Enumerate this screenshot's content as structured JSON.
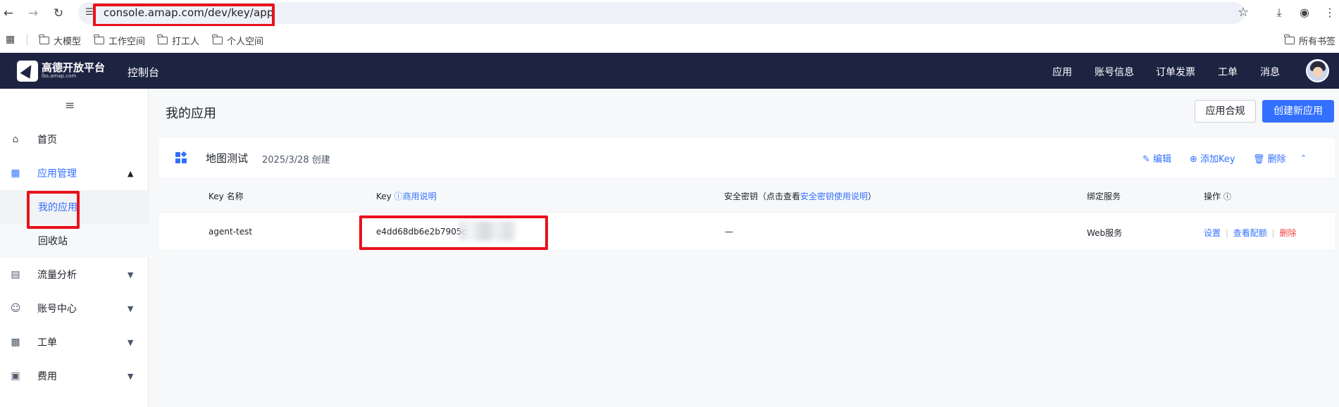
{
  "browser": {
    "url": "console.amap.com/dev/key/app",
    "bookmarks": [
      "大模型",
      "工作空间",
      "打工人",
      "个人空间"
    ],
    "all_bookmarks": "所有书签"
  },
  "topnav": {
    "logo_name": "高德开放平台",
    "logo_domain": "lbs.amap.com",
    "console": "控制台",
    "links": [
      "应用",
      "账号信息",
      "订单发票",
      "工单",
      "消息"
    ]
  },
  "sidebar": {
    "items": [
      {
        "label": "首页",
        "icon": "home-icon"
      },
      {
        "label": "应用管理",
        "icon": "grid-icon"
      },
      {
        "label": "我的应用",
        "icon": ""
      },
      {
        "label": "回收站",
        "icon": ""
      },
      {
        "label": "流量分析",
        "icon": "chart-icon"
      },
      {
        "label": "账号中心",
        "icon": "user-icon"
      },
      {
        "label": "工单",
        "icon": "ticket-icon"
      },
      {
        "label": "费用",
        "icon": "billing-icon"
      }
    ]
  },
  "main": {
    "title": "我的应用",
    "compliance_button": "应用合规",
    "create_button": "创建新应用"
  },
  "app_card": {
    "name": "地图测试",
    "created": "2025/3/28 创建",
    "actions": [
      "编辑",
      "添加Key",
      "删除"
    ],
    "columns": {
      "key_name": "Key 名称",
      "key": "Key",
      "key_help": "商用说明",
      "secret_prefix": "安全密钥（点击查看",
      "secret_link": "安全密钥使用说明",
      "secret_suffix": "）",
      "service": "绑定服务",
      "ops": "操作"
    },
    "rows": [
      {
        "key_name": "agent-test",
        "key": "e4dd68db6e2b7905c",
        "secret": "—",
        "service": "Web服务",
        "ops": [
          "设置",
          "查看配额",
          "删除"
        ]
      }
    ]
  },
  "colors": {
    "brand": "#3370ff",
    "nav_bg": "#1d2442",
    "danger": "#f53f3f",
    "highlight": "#e8121c"
  }
}
